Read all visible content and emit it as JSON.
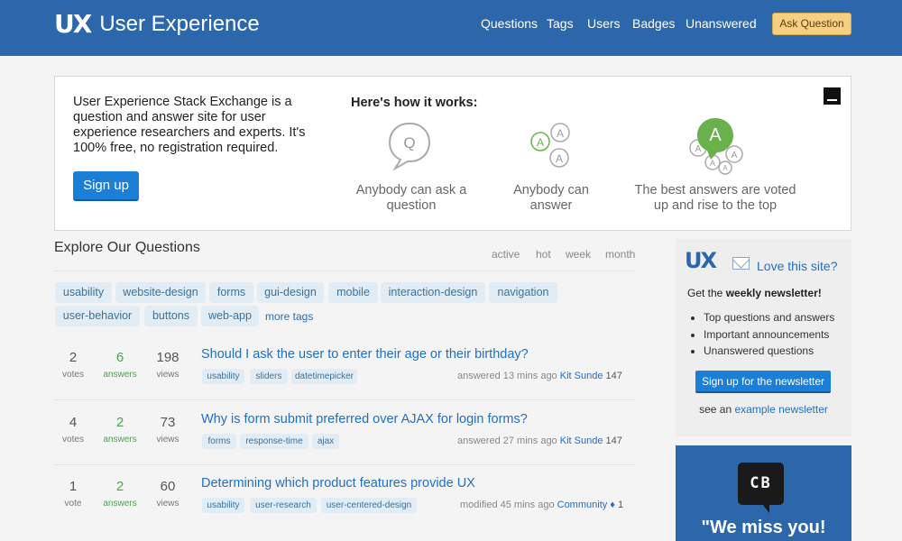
{
  "header": {
    "logo_mark": "UX",
    "site_name": "User Experience",
    "nav": [
      "Questions",
      "Tags",
      "Users",
      "Badges",
      "Unanswered"
    ],
    "ask_label": "Ask Question"
  },
  "intro": {
    "text": "User Experience Stack Exchange is a question and answer site for user experience researchers and experts. It's 100% free, no registration required.",
    "signup_label": "Sign up",
    "how_title": "Here's how it works:",
    "steps": [
      {
        "caption": "Anybody can ask a question",
        "icon": "question-bubble-icon"
      },
      {
        "caption": "Anybody can answer",
        "icon": "answer-bubbles-icon"
      },
      {
        "caption": "The best answers are voted up and rise to the top",
        "icon": "top-answer-icon"
      }
    ]
  },
  "explore": {
    "title": "Explore Our Questions",
    "sort_tabs": [
      "active",
      "hot",
      "week",
      "month"
    ],
    "tags": [
      "usability",
      "website-design",
      "forms",
      "gui-design",
      "mobile",
      "interaction-design",
      "navigation",
      "user-behavior",
      "buttons",
      "web-app"
    ],
    "more_tags": "more tags"
  },
  "questions": [
    {
      "votes": "2",
      "votes_label": "votes",
      "answers": "6",
      "answers_label": "answers",
      "views": "198",
      "views_label": "views",
      "title": "Should I ask the user to enter their age or their birthday?",
      "tags": [
        "usability",
        "sliders",
        "datetimepicker"
      ],
      "meta": "answered 13 mins ago",
      "user": "Kit Sunde",
      "rep": "147"
    },
    {
      "votes": "4",
      "votes_label": "votes",
      "answers": "2",
      "answers_label": "answers",
      "views": "73",
      "views_label": "views",
      "title": "Why is form submit preferred over AJAX for login forms?",
      "tags": [
        "forms",
        "response-time",
        "ajax"
      ],
      "meta": "answered 27 mins ago",
      "user": "Kit Sunde",
      "rep": "147"
    },
    {
      "votes": "1",
      "votes_label": "vote",
      "answers": "2",
      "answers_label": "answers",
      "views": "60",
      "views_label": "views",
      "title": "Determining which product features provide UX",
      "tags": [
        "usability",
        "user-research",
        "user-centered-design"
      ],
      "meta": "modified 45 mins ago",
      "user": "Community ♦",
      "rep": "1"
    }
  ],
  "sidebar": {
    "logo_mark": "UX",
    "love": "Love this site?",
    "get_prefix": "Get the ",
    "get_bold": "weekly newsletter!",
    "list": [
      "Top questions and answers",
      "Important announcements",
      "Unanswered questions"
    ],
    "btn": "Sign up for the newsletter",
    "see_an": "see an ",
    "example_link": "example newsletter"
  },
  "cb": {
    "initials": "CB",
    "headline": "\"We miss you!"
  },
  "colors": {
    "header_bg": "#2c67ab",
    "accent_blue": "#1c7fd7",
    "link": "#1f6fc5",
    "answers_green": "#4aa44a",
    "ask_btn": "#f5d083"
  }
}
